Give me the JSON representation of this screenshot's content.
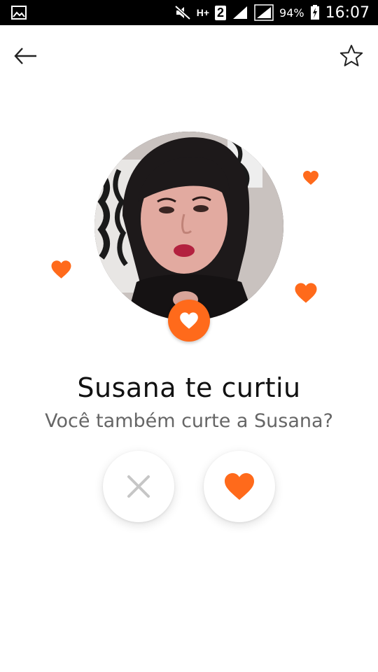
{
  "status_bar": {
    "battery_percent": "94%",
    "network_type": "H+",
    "sim_slot": "2",
    "time": "16:07"
  },
  "profile": {
    "name": "Susana",
    "photo_description_icon": "avatar",
    "liked_badge_icon": "heart-icon"
  },
  "message": {
    "title": "Susana te curtiu",
    "subtitle": "Você também curte a Susana?"
  },
  "actions": {
    "dislike_icon": "close-icon",
    "like_icon": "heart-icon"
  },
  "colors": {
    "accent": "#ff6a1b",
    "close_gray": "#c6c6c6",
    "title_text": "#111111",
    "subtitle_text": "#666666"
  }
}
